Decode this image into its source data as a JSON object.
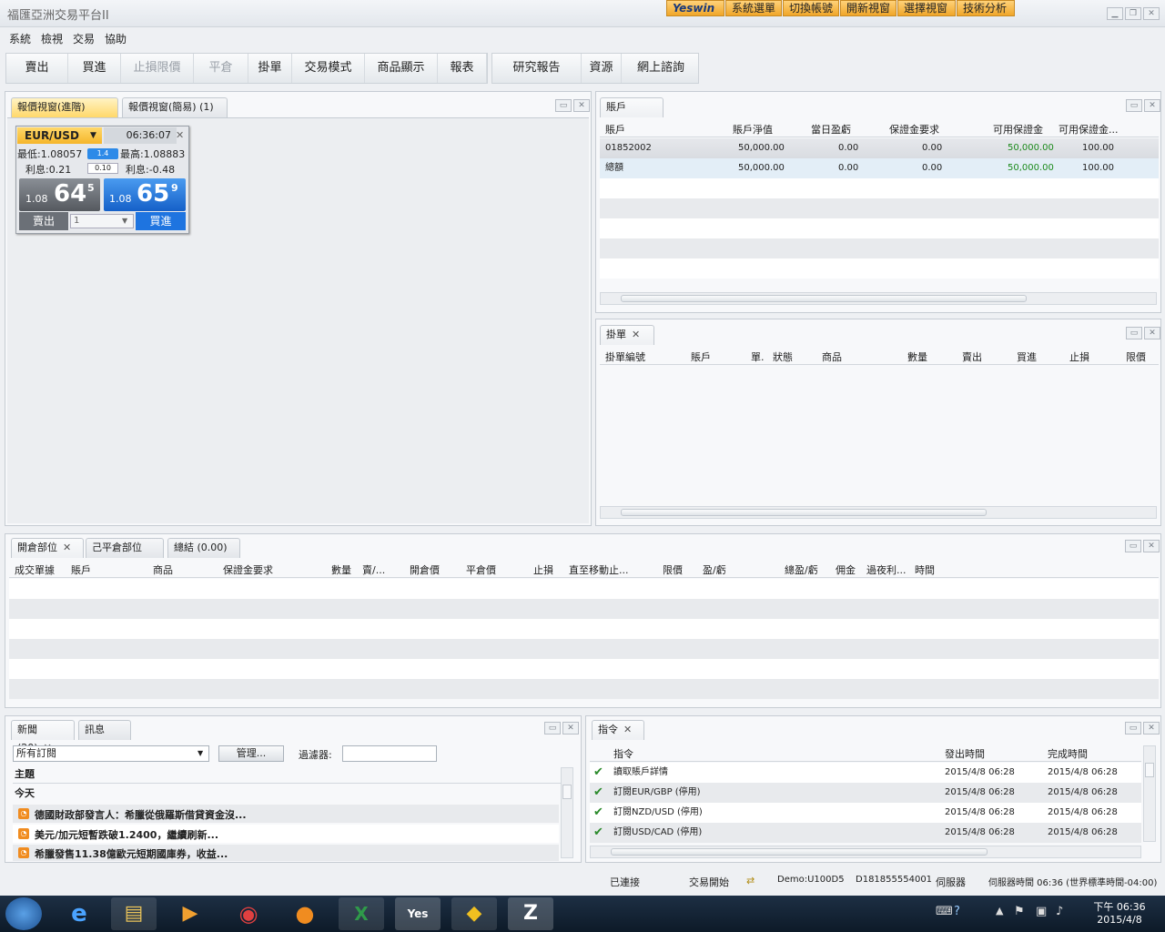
{
  "app": {
    "title": "福匯亞洲交易平台II"
  },
  "topbuttons": [
    {
      "label": "Yeswin"
    },
    {
      "label": "系統選單"
    },
    {
      "label": "切換帳號"
    },
    {
      "label": "開新視窗"
    },
    {
      "label": "選擇視窗"
    },
    {
      "label": "技術分析"
    }
  ],
  "menu": [
    "系統",
    "檢視",
    "交易",
    "協助"
  ],
  "toolbar": [
    "賣出",
    "買進",
    "止損限價",
    "平倉",
    "掛單",
    "交易模式",
    "商品顯示",
    "報表",
    "研究報告",
    "資源",
    "網上諮詢"
  ],
  "quote_tabs": [
    {
      "label": "報價視窗(進階) (1)",
      "close": "✕"
    },
    {
      "label": "報價視窗(簡易) (1)"
    }
  ],
  "quote": {
    "symbol": "EUR/USD",
    "time": "06:36:07",
    "low": "最低:1.08057",
    "high": "最高:1.08883",
    "spread": "1.4",
    "interest_sell": "利息:0.21",
    "lot": "0.10",
    "interest_buy": "利息:-0.48",
    "sell_prefix": "1.08",
    "sell_big": "64",
    "sell_sup": "5",
    "buy_prefix": "1.08",
    "buy_big": "65",
    "buy_sup": "9",
    "sell_label": "賣出",
    "buy_label": "買進",
    "amount": "1"
  },
  "accounts": {
    "tab": "賬戶 (1)",
    "headers": [
      "賬戶",
      "賬戶淨值",
      "當日盈虧",
      "保證金要求",
      "可用保證金",
      "可用保證金..."
    ],
    "rows": [
      [
        "01852002",
        "50,000.00",
        "0.00",
        "0.00",
        "50,000.00",
        "100.00"
      ],
      [
        "總額",
        "50,000.00",
        "0.00",
        "0.00",
        "50,000.00",
        "100.00"
      ]
    ]
  },
  "orders": {
    "tab": "掛單",
    "headers": [
      "掛單編號",
      "賬戶",
      "單.",
      "狀態",
      "商品",
      "數量",
      "賣出",
      "買進",
      "止損",
      "限價"
    ]
  },
  "positions": {
    "tabs": [
      "開倉部位",
      "己平倉部位",
      "總結 (0.00)"
    ],
    "headers": [
      "成交單據",
      "賬戶",
      "商品",
      "保證金要求",
      "數量",
      "賣/...",
      "開倉價",
      "平倉價",
      "止損",
      "直至移動止...",
      "限價",
      "盈/虧",
      "總盈/虧",
      "佣金",
      "過夜利...",
      "時間"
    ]
  },
  "news": {
    "tabs": [
      "新聞(20)",
      "訊息"
    ],
    "subscription": "所有訂閱",
    "manage": "管理...",
    "filter_label": "過濾器:",
    "subject_header": "主題",
    "group": "今天",
    "items": [
      "德國財政部發言人：希臘從俄羅斯借貸資金沒...",
      "美元/加元短暫跌破1.2400，繼續刷新...",
      "希臘發售11.38億歐元短期國庫券，收益..."
    ]
  },
  "commands": {
    "tab": "指令",
    "headers": [
      "指令",
      "發出時間",
      "完成時間"
    ],
    "rows": [
      [
        "讀取賬戶詳情",
        "2015/4/8 06:28",
        "2015/4/8 06:28"
      ],
      [
        "訂閱EUR/GBP (停用)",
        "2015/4/8 06:28",
        "2015/4/8 06:28"
      ],
      [
        "訂閱NZD/USD (停用)",
        "2015/4/8 06:28",
        "2015/4/8 06:28"
      ],
      [
        "訂閱USD/CAD (停用)",
        "2015/4/8 06:28",
        "2015/4/8 06:28"
      ]
    ]
  },
  "status": {
    "connected": "已連接",
    "trading": "交易開始",
    "demo": "Demo:U100D5",
    "id": "D181855554001",
    "server": "伺服器",
    "server_time": "伺服器時間 06:36 (世界標準時間-04:00)"
  },
  "clock": {
    "time": "下午 06:36",
    "date": "2015/4/8"
  },
  "colors": {
    "accent": "#ffd86a",
    "buy": "#1e74e0",
    "sell": "#6a6f76",
    "positive": "#1c8a1c"
  }
}
